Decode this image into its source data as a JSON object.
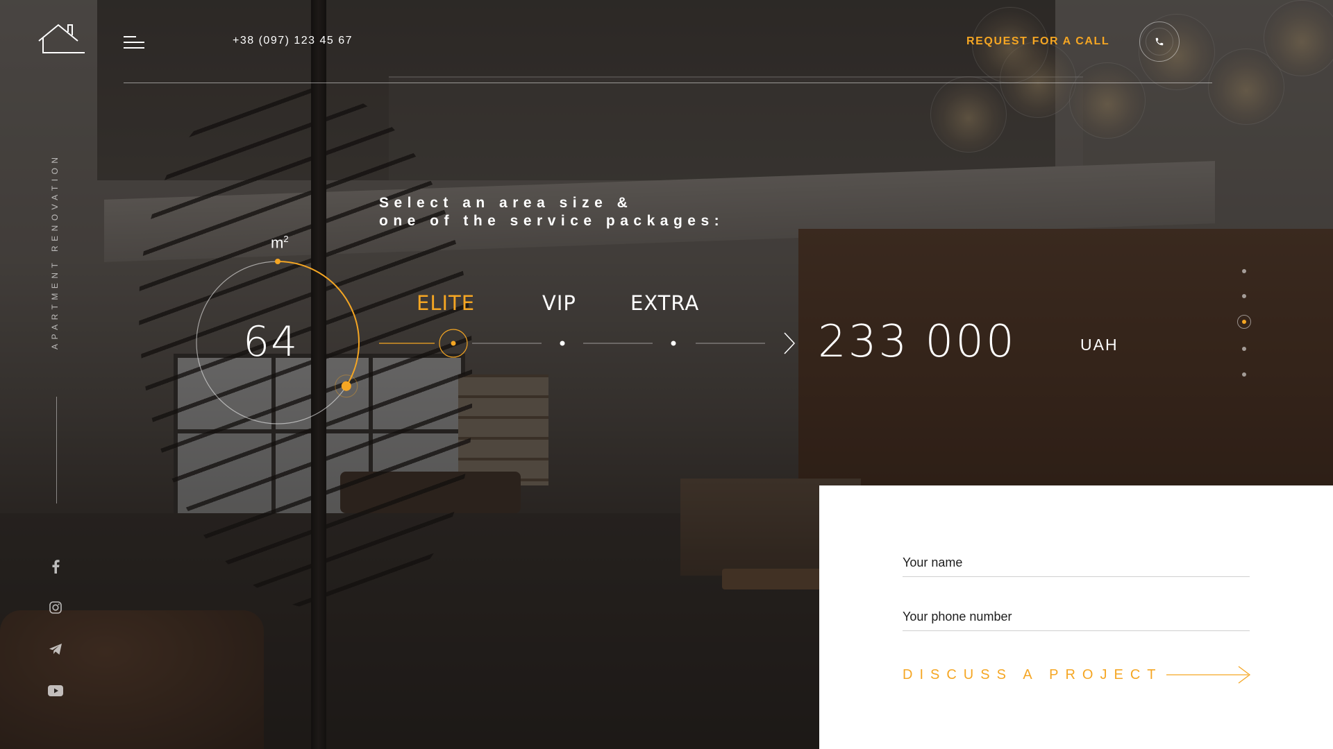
{
  "header": {
    "phone": "+38 (097) 123 45 67",
    "request_call": "REQUEST FOR A CALL"
  },
  "sidebar": {
    "vertical_title": "APARTMENT RENOVATION",
    "socials": [
      "facebook-icon",
      "instagram-icon",
      "telegram-icon",
      "youtube-icon"
    ]
  },
  "calculator": {
    "heading_line1": "Select an area size &",
    "heading_line2": "one of the service packages:",
    "area_unit": "m",
    "area_unit_sup": "2",
    "area_value": "64",
    "area_fill": 0.34,
    "packages": [
      {
        "label": "ELITE",
        "active": true
      },
      {
        "label": "VIP",
        "active": false
      },
      {
        "label": "EXTRA",
        "active": false
      }
    ],
    "price": "233 000",
    "currency": "UAH"
  },
  "slider": {
    "count": 5,
    "active_index": 2
  },
  "form": {
    "name_placeholder": "Your name",
    "phone_placeholder": "Your phone number",
    "submit_label": "DISCUSS A PROJECT"
  },
  "colors": {
    "accent": "#f5a623",
    "panel": "#ffffff"
  }
}
